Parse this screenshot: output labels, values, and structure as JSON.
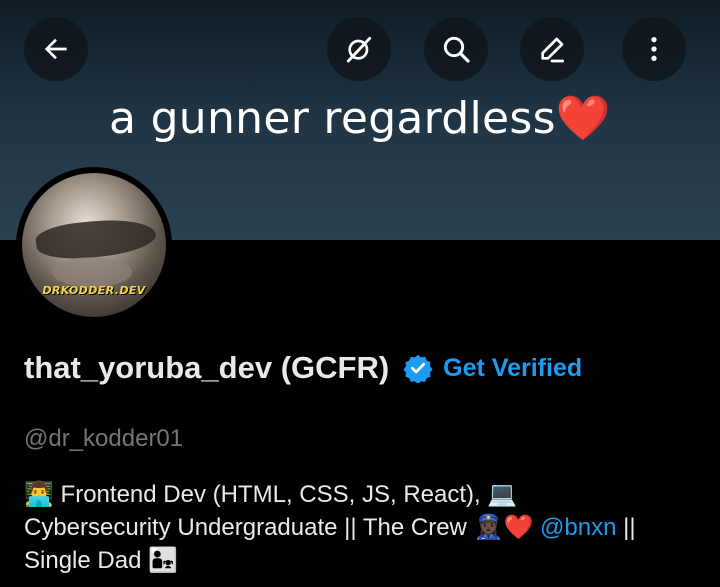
{
  "banner": {
    "text": "a gunner regardless",
    "heart": "❤️"
  },
  "topbar": {
    "back_icon": "arrow-left-icon",
    "grok_icon": "grok-icon",
    "search_icon": "search-icon",
    "edit_icon": "pencil-icon",
    "more_icon": "more-vertical-icon"
  },
  "avatar": {
    "caption": "DRKODDER.DEV"
  },
  "profile": {
    "display_name": "that_yoruba_dev (GCFR)",
    "verified_icon": "verified-badge-icon",
    "get_verified_label": "Get Verified",
    "handle": "@dr_kodder01"
  },
  "bio": {
    "line1_emoji": "👨‍💻",
    "line1_text": " Frontend Dev (HTML, CSS, JS, React), ",
    "line1_emoji2": "💻",
    "line2_text": "Cybersecurity Undergraduate || The Crew ",
    "line2_emoji": "👮🏿‍♀️",
    "line2_heart": "❤️",
    "mention": "@bnxn",
    "line2_tail": " ||",
    "line3_text": "Single Dad ",
    "line3_emoji": "👨‍👧"
  },
  "colors": {
    "accent": "#1d9bf0",
    "background": "#000000",
    "text_primary": "#e7e9ea",
    "text_secondary": "#71767b",
    "avatar_caption": "#f4d24a"
  }
}
